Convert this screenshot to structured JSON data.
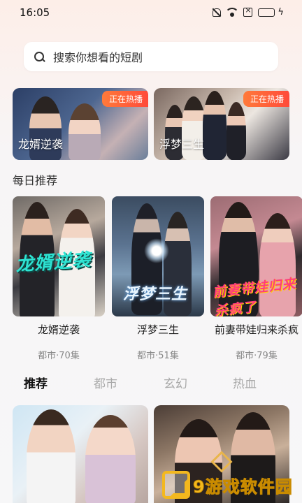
{
  "status": {
    "time": "16:05",
    "icons": [
      "mute-icon",
      "wifi-icon",
      "sim-off-icon",
      "battery-icon",
      "charging-icon"
    ]
  },
  "search": {
    "placeholder": "搜索你想看的短剧"
  },
  "banners": [
    {
      "title": "龙婿逆袭",
      "badge": "正在热播"
    },
    {
      "title": "浮梦三生",
      "badge": "正在热播"
    }
  ],
  "daily": {
    "section_title": "每日推荐",
    "items": [
      {
        "title": "龙婿逆袭",
        "meta": "都市·70集",
        "poster_text": "龙婿逆袭"
      },
      {
        "title": "浮梦三生",
        "meta": "都市·51集",
        "poster_text": "浮梦三生"
      },
      {
        "title": "前妻带娃归来杀疯",
        "meta": "都市·79集",
        "poster_text": "前妻带娃归来杀疯了"
      }
    ]
  },
  "tabs": [
    {
      "label": "推荐",
      "active": true
    },
    {
      "label": "都市",
      "active": false
    },
    {
      "label": "玄幻",
      "active": false
    },
    {
      "label": "热血",
      "active": false
    }
  ],
  "watermark": {
    "text": "9游戏软件园"
  },
  "colors": {
    "badge": "#ff5a3a",
    "active_tab": "#111111",
    "inactive_tab": "#aaaaaa",
    "watermark": "#f3b81e"
  }
}
